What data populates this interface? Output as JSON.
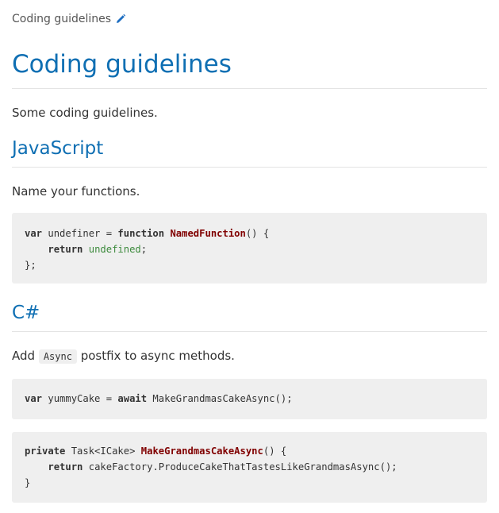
{
  "breadcrumb": {
    "label": "Coding guidelines",
    "edit_icon": "pencil-icon"
  },
  "title": "Coding guidelines",
  "intro": "Some coding guidelines.",
  "sections": {
    "js": {
      "heading": "JavaScript",
      "text": "Name your functions.",
      "code": {
        "l1_kw1": "var",
        "l1_mid": " undefiner = ",
        "l1_kw2": "function",
        "l1_sp": " ",
        "l1_fn": "NamedFunction",
        "l1_end": "() {",
        "l2_indent": "    ",
        "l2_kw": "return",
        "l2_sp": " ",
        "l2_lit": "undefined",
        "l2_end": ";",
        "l3": "};"
      }
    },
    "cs": {
      "heading": "C#",
      "text_before": "Add ",
      "inline_code": "Async",
      "text_after": " postfix to async methods.",
      "code1": {
        "kw1": "var",
        "mid": " yummyCake = ",
        "kw2": "await",
        "end": " MakeGrandmasCakeAsync();"
      },
      "code2": {
        "l1_kw": "private",
        "l1_mid": " Task<ICake> ",
        "l1_fn": "MakeGrandmasCakeAsync",
        "l1_end": "() {",
        "l2_indent": "    ",
        "l2_kw": "return",
        "l2_end": " cakeFactory.ProduceCakeThatTastesLikeGrandmasAsync();",
        "l3": "}"
      }
    }
  },
  "colors": {
    "heading": "#0f6fb3",
    "code_bg": "#efefef",
    "code_fn": "#800000",
    "code_lit": "#3c8a3c"
  }
}
